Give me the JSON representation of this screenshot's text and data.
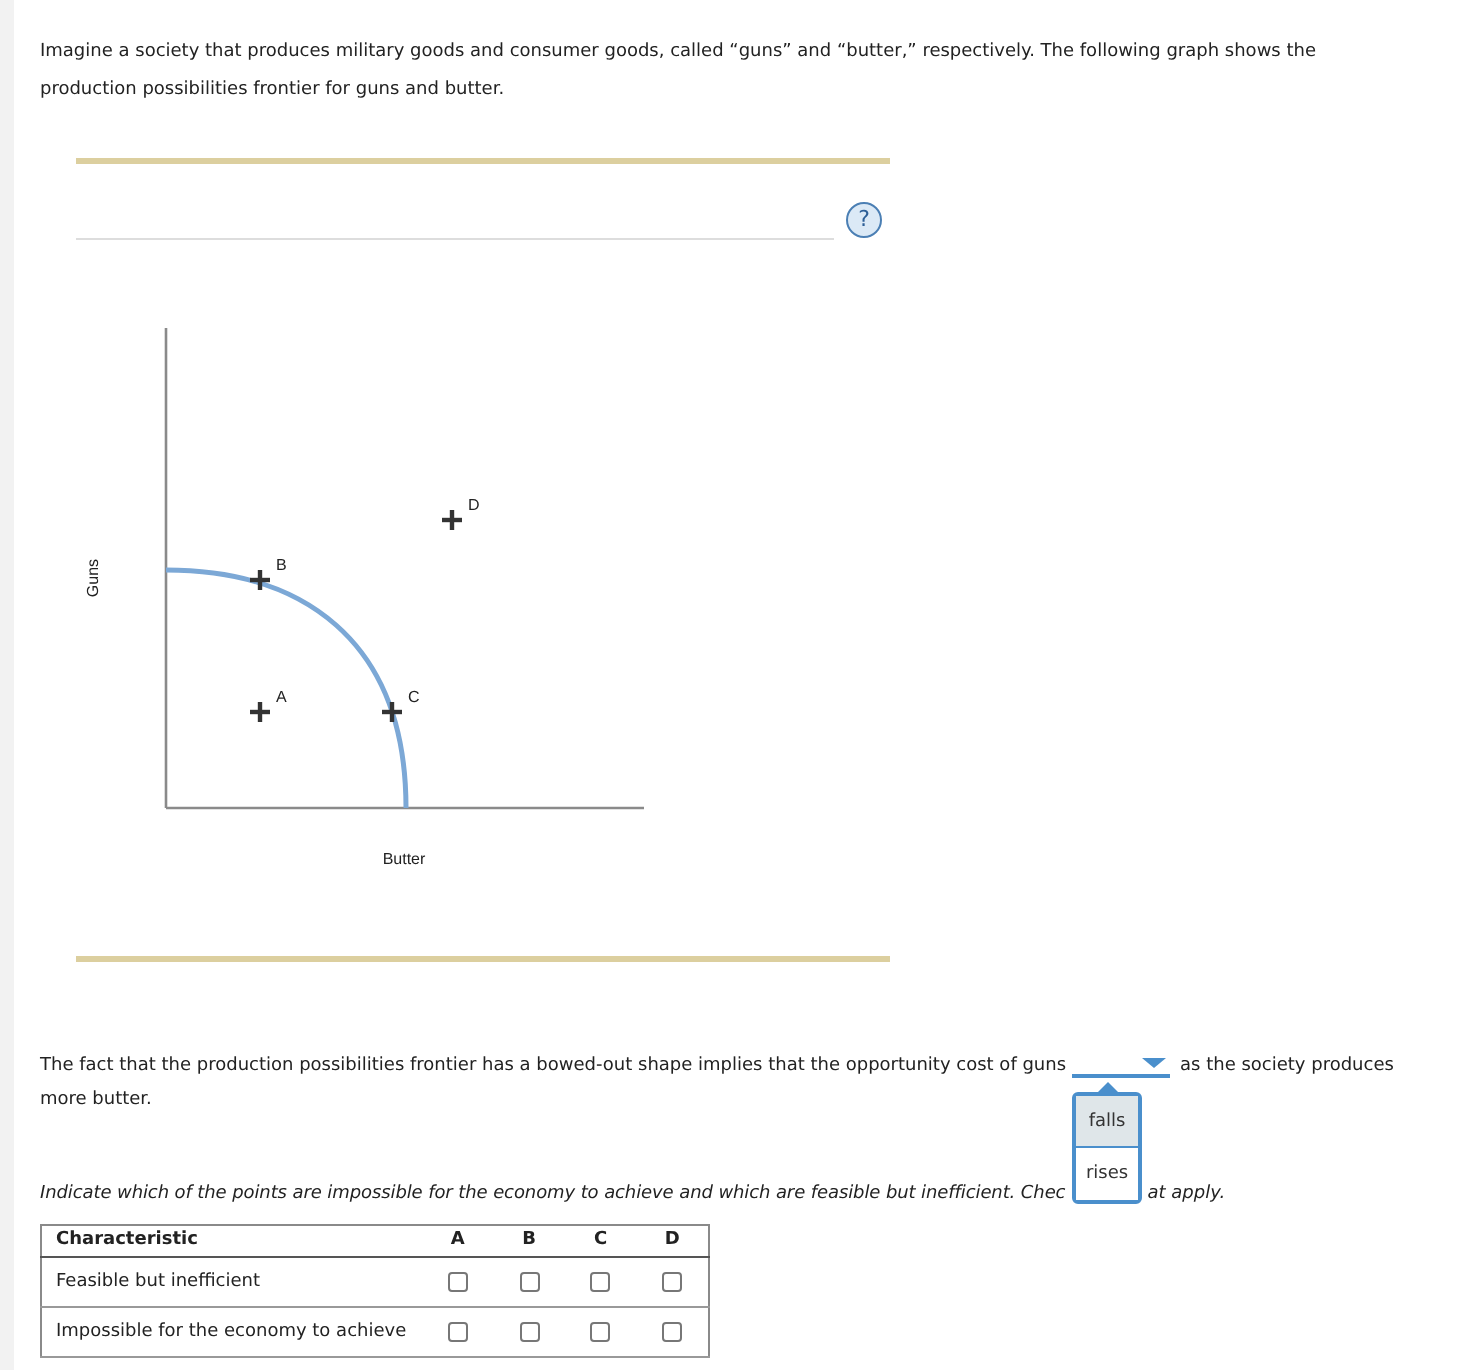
{
  "intro": "Imagine a society that produces military goods and consumer goods, called “guns” and “butter,” respectively. The following graph shows the production possibilities frontier for guns and butter.",
  "graph": {
    "help_button": "?",
    "y_axis_label": "Guns",
    "x_axis_label": "Butter",
    "points": [
      {
        "label": "A"
      },
      {
        "label": "B"
      },
      {
        "label": "C"
      },
      {
        "label": "D"
      }
    ]
  },
  "question": {
    "text_before": "The fact that the production possibilities frontier has a bowed-out shape implies that the opportunity cost of guns",
    "dropdown": {
      "expanded": true,
      "options": [
        {
          "label": "falls",
          "selected": false,
          "highlighted": true
        },
        {
          "label": "rises",
          "selected": false,
          "highlighted": false
        }
      ]
    },
    "text_after": "as the society produces",
    "text_next_line": "more butter."
  },
  "instruction": {
    "text_before_menu": "Indicate which of the points are impossible for the economy to achieve and which are feasible but inefficient. Chec",
    "text_after_menu": "at apply."
  },
  "table": {
    "columns": [
      "Characteristic",
      "A",
      "B",
      "C",
      "D"
    ],
    "rows": [
      {
        "label": "Feasible but inefficient",
        "cells": [
          {
            "checked": false
          },
          {
            "checked": false
          },
          {
            "checked": false
          },
          {
            "checked": false
          }
        ]
      },
      {
        "label": "Impossible for the economy to achieve",
        "cells": [
          {
            "checked": false
          },
          {
            "checked": false
          },
          {
            "checked": false
          },
          {
            "checked": false
          }
        ]
      }
    ]
  }
}
